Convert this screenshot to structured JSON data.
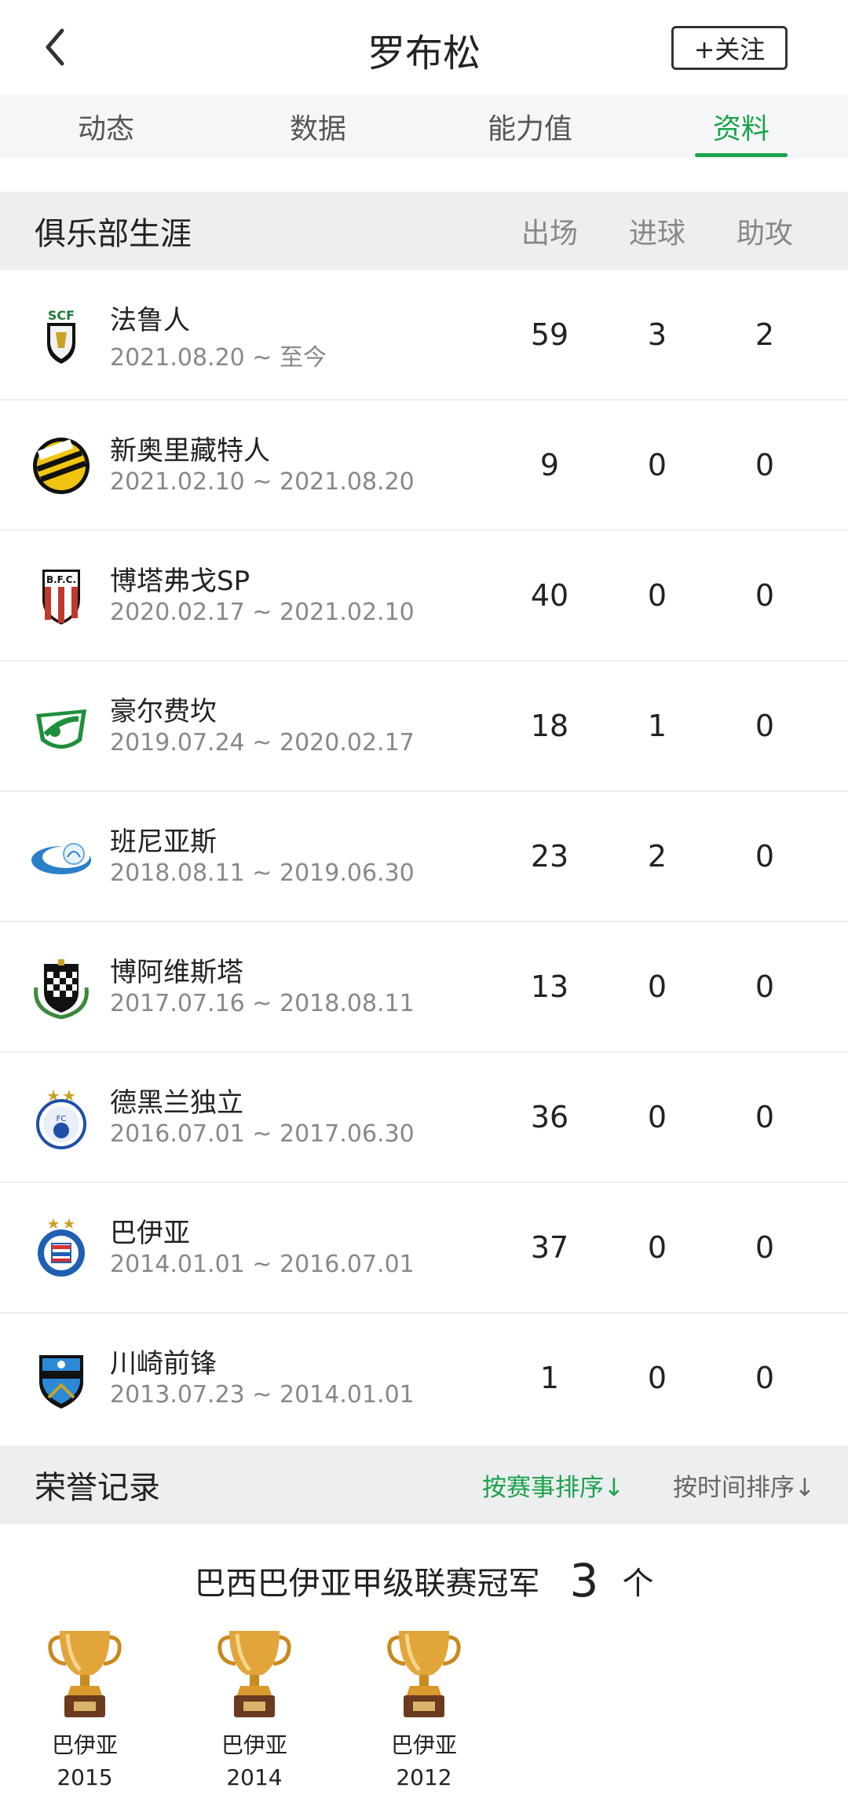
{
  "header": {
    "title": "罗布松",
    "follow_label": "+关注"
  },
  "tabs": [
    {
      "label": "动态",
      "active": false
    },
    {
      "label": "数据",
      "active": false
    },
    {
      "label": "能力值",
      "active": false
    },
    {
      "label": "资料",
      "active": true
    }
  ],
  "club_career": {
    "section_title": "俱乐部生涯",
    "columns": [
      "出场",
      "进球",
      "助攻"
    ],
    "rows": [
      {
        "club": "法鲁人",
        "dates": "2021.08.20 ~ 至今",
        "apps": "59",
        "goals": "3",
        "assists": "2",
        "logo": "farense-crest-icon"
      },
      {
        "club": "新奥里藏特人",
        "dates": "2021.02.10 ~ 2021.08.20",
        "apps": "9",
        "goals": "0",
        "assists": "0",
        "logo": "novorizontino-crest-icon"
      },
      {
        "club": "博塔弗戈SP",
        "dates": "2020.02.17 ~ 2021.02.10",
        "apps": "40",
        "goals": "0",
        "assists": "0",
        "logo": "botafogo-sp-crest-icon"
      },
      {
        "club": "豪尔费坎",
        "dates": "2019.07.24 ~ 2020.02.17",
        "apps": "18",
        "goals": "1",
        "assists": "0",
        "logo": "khor-fakkan-crest-icon"
      },
      {
        "club": "班尼亚斯",
        "dates": "2018.08.11 ~ 2019.06.30",
        "apps": "23",
        "goals": "2",
        "assists": "0",
        "logo": "baniyas-crest-icon"
      },
      {
        "club": "博阿维斯塔",
        "dates": "2017.07.16 ~ 2018.08.11",
        "apps": "13",
        "goals": "0",
        "assists": "0",
        "logo": "boavista-crest-icon"
      },
      {
        "club": "德黑兰独立",
        "dates": "2016.07.01 ~ 2017.06.30",
        "apps": "36",
        "goals": "0",
        "assists": "0",
        "logo": "esteghlal-crest-icon"
      },
      {
        "club": "巴伊亚",
        "dates": "2014.01.01 ~ 2016.07.01",
        "apps": "37",
        "goals": "0",
        "assists": "0",
        "logo": "bahia-crest-icon"
      },
      {
        "club": "川崎前锋",
        "dates": "2013.07.23 ~ 2014.01.01",
        "apps": "1",
        "goals": "0",
        "assists": "0",
        "logo": "kawasaki-frontale-crest-icon"
      }
    ]
  },
  "honors": {
    "section_title": "荣誉记录",
    "sort_by_event": "按赛事排序↓",
    "sort_by_time": "按时间排序↓",
    "title": "巴西巴伊亚甲级联赛冠军",
    "count": "3",
    "count_unit": "个",
    "items": [
      {
        "club": "巴伊亚",
        "year": "2015"
      },
      {
        "club": "巴伊亚",
        "year": "2014"
      },
      {
        "club": "巴伊亚",
        "year": "2012"
      }
    ]
  },
  "colors": {
    "accent": "#1aa34a",
    "section_bg": "#eceef0",
    "tab_bg": "#f5f6f7",
    "muted_text": "#888888"
  }
}
